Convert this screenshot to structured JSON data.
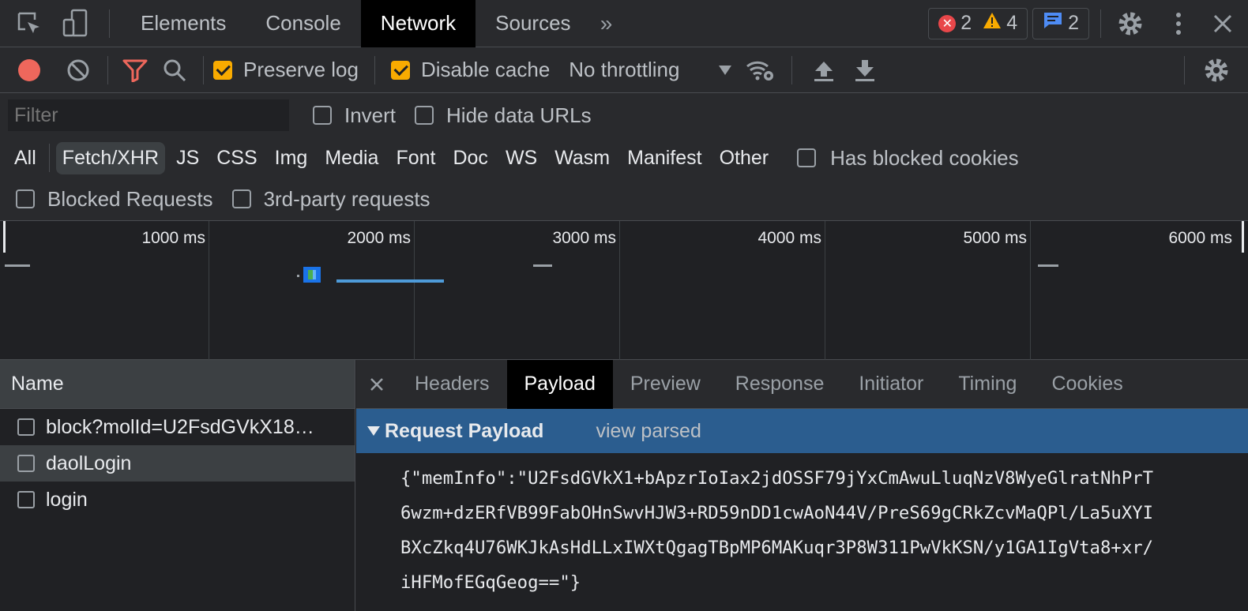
{
  "top_tabs": [
    "Elements",
    "Console",
    "Network",
    "Sources"
  ],
  "active_tab": "Network",
  "counters": {
    "errors": "2",
    "warnings": "4",
    "messages": "2"
  },
  "toolbar": {
    "preserve_log_label": "Preserve log",
    "preserve_log_checked": true,
    "disable_cache_label": "Disable cache",
    "disable_cache_checked": true,
    "throttling": "No throttling"
  },
  "filter": {
    "placeholder": "Filter",
    "invert_label": "Invert",
    "hide_data_urls_label": "Hide data URLs",
    "types": [
      "All",
      "Fetch/XHR",
      "JS",
      "CSS",
      "Img",
      "Media",
      "Font",
      "Doc",
      "WS",
      "Wasm",
      "Manifest",
      "Other"
    ],
    "active_type": "Fetch/XHR",
    "has_blocked_cookies_label": "Has blocked cookies",
    "blocked_requests_label": "Blocked Requests",
    "third_party_label": "3rd-party requests"
  },
  "timeline": {
    "ticks": [
      "1000 ms",
      "2000 ms",
      "3000 ms",
      "4000 ms",
      "5000 ms",
      "6000 ms"
    ]
  },
  "request_list": {
    "header": "Name",
    "rows": [
      "block?molId=U2FsdGVkX18…",
      "daolLogin",
      "login"
    ],
    "selected_index": 1
  },
  "details": {
    "tabs": [
      "Headers",
      "Payload",
      "Preview",
      "Response",
      "Initiator",
      "Timing",
      "Cookies"
    ],
    "active_tab": "Payload",
    "section_title": "Request Payload",
    "view_parsed_label": "view parsed",
    "payload_lines": [
      "{\"memInfo\":\"U2FsdGVkX1+bApzrIoIax2jdOSSF79jYxCmAwuLluqNzV8WyeGlratNhPrT",
      "6wzm+dzERfVB99FabOHnSwvHJW3+RD59nDD1cwAoN44V/PreS69gCRkZcvMaQPl/La5uXYI",
      "BXcZkq4U76WKJkAsHdLLxIWXtQgagTBpMP6MAKuqr3P8W311PwVkKSN/y1GA1IgVta8+xr/",
      "iHFMofEGqGeog==\"}"
    ]
  },
  "colors": {
    "accent_orange": "#f9ab00",
    "record_red": "#ee675c",
    "selection_blue": "#2b5d8f"
  }
}
